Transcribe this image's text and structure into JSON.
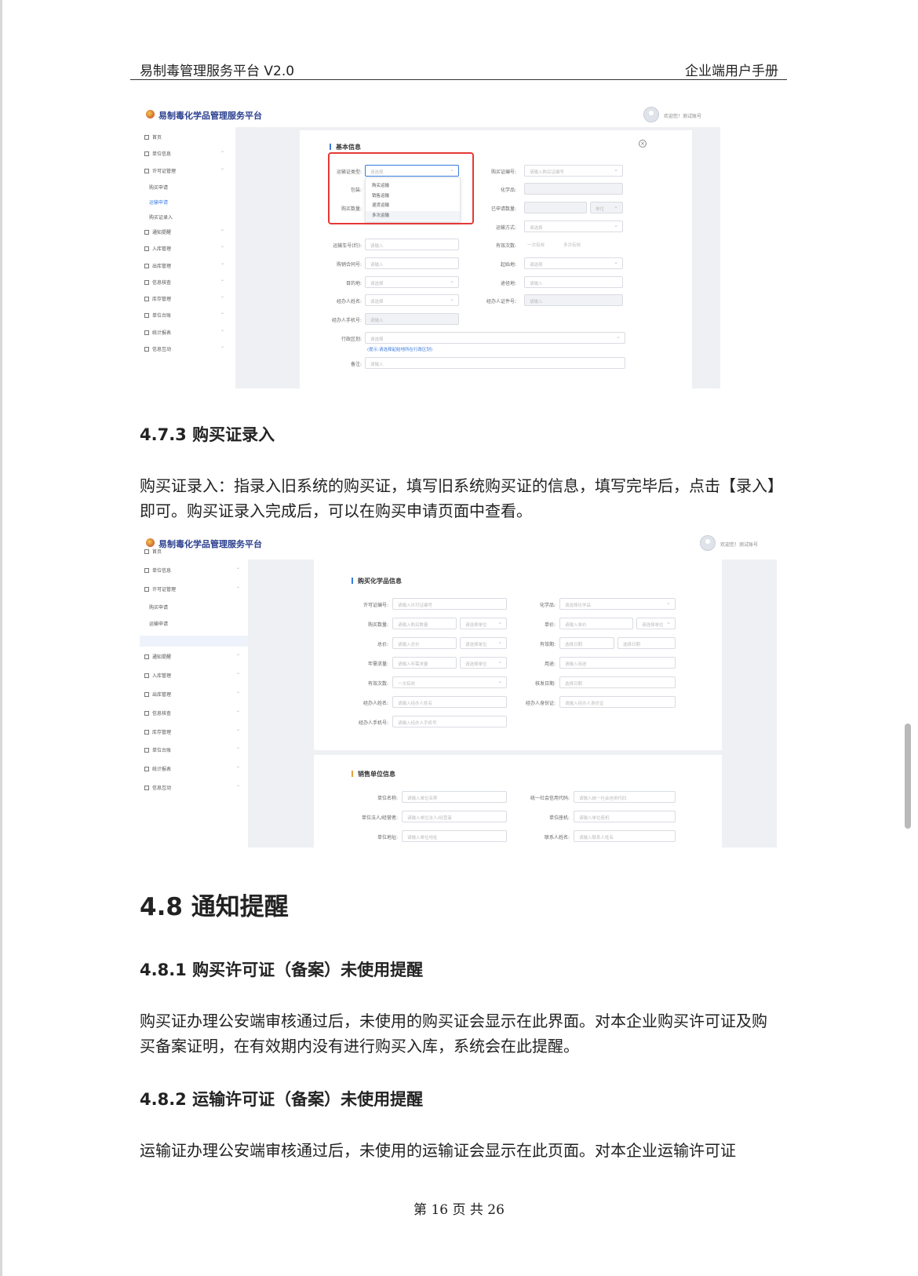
{
  "header": {
    "left": "易制毒管理服务平台 V2.0",
    "right": "企业端用户手册"
  },
  "app": {
    "logo_text": "易制毒化学品管理服务平台",
    "greeting": "欢迎您！测试账号",
    "menu": [
      "首页",
      "单位信息",
      "许可证管理",
      "通知提醒",
      "入库管理",
      "出库管理",
      "信息核查",
      "库存管理",
      "单位台账",
      "统计报表",
      "信息互动"
    ],
    "submenu": [
      "购买申请",
      "运输申请",
      "购买证录入"
    ]
  },
  "shot1": {
    "section_title": "基本信息",
    "dropdown_options": [
      "购买运输",
      "销售运输",
      "退货运输",
      "多次运输"
    ],
    "link": "(提示:请选择起始地所在行政区划)",
    "left_fields": [
      {
        "label": "运输证类型:",
        "placeholder": "请选择"
      },
      {
        "label": "包装:",
        "placeholder": ""
      },
      {
        "label": "购买数量:",
        "placeholder": ""
      },
      {
        "label": "运输方式:",
        "placeholder": ""
      },
      {
        "label": "运输车号(约):",
        "placeholder": "请输入"
      },
      {
        "label": "购销合同号:",
        "placeholder": "请输入"
      },
      {
        "label": "目的地:",
        "placeholder": "请选择"
      },
      {
        "label": "经办人姓名:",
        "placeholder": "请选择"
      },
      {
        "label": "经办人手机号:",
        "placeholder": "请输入"
      },
      {
        "label": "行政区划:",
        "placeholder": "请选择"
      },
      {
        "label": "备注:",
        "placeholder": "请输入"
      }
    ],
    "right_fields": [
      {
        "label": "购买证编号:",
        "placeholder": "请输入购买证编号"
      },
      {
        "label": "化学品:",
        "placeholder": ""
      },
      {
        "label": "已申请数量:",
        "placeholder": "",
        "unit": "单位"
      },
      {
        "label": "运输方式:",
        "placeholder": "请选择"
      },
      {
        "label": "有效次数:",
        "radio1": "一次有效",
        "radio2": "多次有效"
      },
      {
        "label": "起始地:",
        "placeholder": "请选择"
      },
      {
        "label": "途径地:",
        "placeholder": "请输入"
      },
      {
        "label": "经办人证件号:",
        "placeholder": "请输入"
      }
    ]
  },
  "shot2": {
    "section1_title": "购买化学品信息",
    "section2_title": "销售单位信息",
    "rows1": [
      {
        "l_label": "许可证编号:",
        "l_ph": "请输入许可证编号",
        "r_label": "化学品:",
        "r_ph": "请选择化学品"
      },
      {
        "l_label": "购买数量:",
        "l_ph": "请输入购买数量",
        "l_unit": "请选择单位",
        "r_label": "单价:",
        "r_ph": "请输入单价",
        "r_unit": "请选择单位"
      },
      {
        "l_label": "总价:",
        "l_ph": "请输入总价",
        "l_unit": "请选择单位",
        "r_label": "有效期:",
        "r_ph": "选择日期",
        "r_ph2": "选择日期"
      },
      {
        "l_label": "年需求量:",
        "l_ph": "请输入年需求量",
        "l_unit": "请选择单位",
        "r_label": "用途:",
        "r_ph": "请输入用途"
      },
      {
        "l_label": "有效次数:",
        "l_ph": "一次有效",
        "r_label": "核发日期:",
        "r_ph": "选择日期"
      },
      {
        "l_label": "经办人姓名:",
        "l_ph": "请输入经办人姓名",
        "r_label": "经办人身份证:",
        "r_ph": "请输入经办人身份证"
      },
      {
        "l_label": "经办人手机号:",
        "l_ph": "请输入经办人手机号"
      }
    ],
    "rows2": [
      {
        "l_label": "单位名称:",
        "l_ph": "请输入单位名称",
        "r_label": "统一社会信用代码:",
        "r_ph": "请输入统一社会信用代码"
      },
      {
        "l_label": "单位法人/经营者:",
        "l_ph": "请输入单位法人/经营者",
        "r_label": "单位座机:",
        "r_ph": "请输入单位座机"
      },
      {
        "l_label": "单位地址:",
        "l_ph": "请输入单位地址",
        "r_label": "联系人姓名:",
        "r_ph": "请输入联系人姓名"
      }
    ]
  },
  "sections": {
    "s473_title": "4.7.3 购买证录入",
    "s473_text": "购买证录入：指录入旧系统的购买证，填写旧系统购买证的信息，填写完毕后，点击【录入】即可。购买证录入完成后，可以在购买申请页面中查看。",
    "s48_title": "4.8 通知提醒",
    "s481_title": "4.8.1 购买许可证（备案）未使用提醒",
    "s481_text": "购买证办理公安端审核通过后，未使用的购买证会显示在此界面。对本企业购买许可证及购买备案证明，在有效期内没有进行购买入库，系统会在此提醒。",
    "s482_title": "4.8.2 运输许可证（备案）未使用提醒",
    "s482_text": "运输证办理公安端审核通过后，未使用的运输证会显示在此页面。对本企业运输许可证"
  },
  "footer": "第 16 页 共 26"
}
